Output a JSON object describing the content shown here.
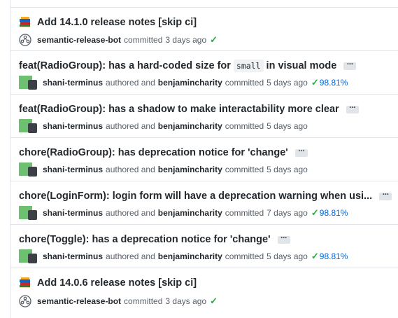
{
  "commits": [
    {
      "kind": "release",
      "title": "Add 14.1.0 release notes [skip ci]",
      "author": "semantic-release-bot",
      "action": "committed",
      "time": "3 days ago",
      "status": "success"
    },
    {
      "kind": "pair",
      "title_before": "feat(RadioGroup): has a hard-coded size for",
      "code": "small",
      "title_after": "in visual mode",
      "author": "shani-terminus",
      "authored_text": "authored and",
      "committer": "benjamincharity",
      "action": "committed",
      "time": "5 days ago",
      "coverage": "98.81%"
    },
    {
      "kind": "pair",
      "title": "feat(RadioGroup): has a shadow to make interactability more clear",
      "author": "shani-terminus",
      "authored_text": "authored and",
      "committer": "benjamincharity",
      "action": "committed",
      "time": "5 days ago"
    },
    {
      "kind": "pair",
      "title": "chore(RadioGroup): has deprecation notice for 'change'",
      "author": "shani-terminus",
      "authored_text": "authored and",
      "committer": "benjamincharity",
      "action": "committed",
      "time": "5 days ago"
    },
    {
      "kind": "pair",
      "title": "chore(LoginForm): login form will have a deprecation warning when usi...",
      "author": "shani-terminus",
      "authored_text": "authored and",
      "committer": "benjamincharity",
      "action": "committed",
      "time": "7 days ago",
      "coverage": "98.81%"
    },
    {
      "kind": "pair",
      "title": "chore(Toggle): has a deprecation notice for 'change'",
      "author": "shani-terminus",
      "authored_text": "authored and",
      "committer": "benjamincharity",
      "action": "committed",
      "time": "5 days ago",
      "coverage": "98.81%"
    },
    {
      "kind": "release",
      "title": "Add 14.0.6 release notes [skip ci]",
      "author": "semantic-release-bot",
      "action": "committed",
      "time": "3 days ago",
      "status": "success"
    }
  ],
  "icons": {
    "books": "books-icon",
    "bot": "bot-avatar-icon",
    "check": "check-icon",
    "ellipsis": "ellipsis-icon"
  },
  "colors": {
    "success": "#28a745",
    "link": "#0366d6",
    "avatar_green": "#6cc070",
    "border": "#e1e4e8"
  }
}
